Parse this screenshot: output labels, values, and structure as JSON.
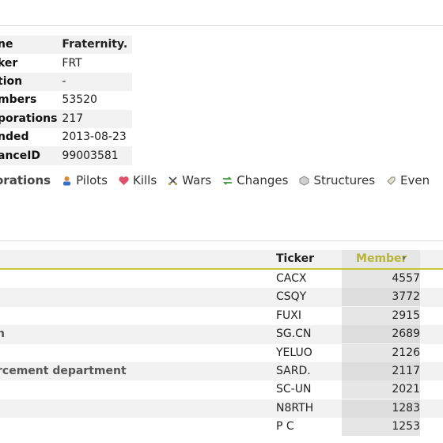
{
  "info": [
    {
      "key": "ne",
      "value": "Fraternity."
    },
    {
      "key": "ker",
      "value": "FRT"
    },
    {
      "key": "tion",
      "value": "-"
    },
    {
      "key": "mbers",
      "value": "53520"
    },
    {
      "key": "porations",
      "value": "217"
    },
    {
      "key": "nded",
      "value": "2013-08-23"
    },
    {
      "key": "anceID",
      "value": "99003581"
    }
  ],
  "tabs": [
    {
      "label": "orations",
      "icon": "corporations-icon",
      "active": true
    },
    {
      "label": "Pilots",
      "icon": "pilot-icon"
    },
    {
      "label": "Kills",
      "icon": "heart-icon"
    },
    {
      "label": "Wars",
      "icon": "crossed-swords-icon"
    },
    {
      "label": "Changes",
      "icon": "arrows-icon"
    },
    {
      "label": "Structures",
      "icon": "structure-icon"
    },
    {
      "label": "Even",
      "icon": "tag-icon"
    }
  ],
  "table": {
    "headers": {
      "ticker": "Ticker",
      "member": "Member"
    },
    "accent": "#c8c836",
    "rows": [
      {
        "name": "",
        "ticker": "CACX",
        "member": "4557"
      },
      {
        "name": "",
        "ticker": "CSQY",
        "member": "3772"
      },
      {
        "name": "",
        "ticker": "FUXI",
        "member": "2915"
      },
      {
        "name": "n",
        "ticker": "SG.CN",
        "member": "2689"
      },
      {
        "name": "",
        "ticker": "YELUO",
        "member": "2126"
      },
      {
        "name": "rcement department",
        "ticker": "SARD.",
        "member": "2117"
      },
      {
        "name": "",
        "ticker": "SC-UN",
        "member": "2021"
      },
      {
        "name": "",
        "ticker": "N8RTH",
        "member": "1283"
      },
      {
        "name": "",
        "ticker": "P C",
        "member": "1253"
      }
    ]
  }
}
